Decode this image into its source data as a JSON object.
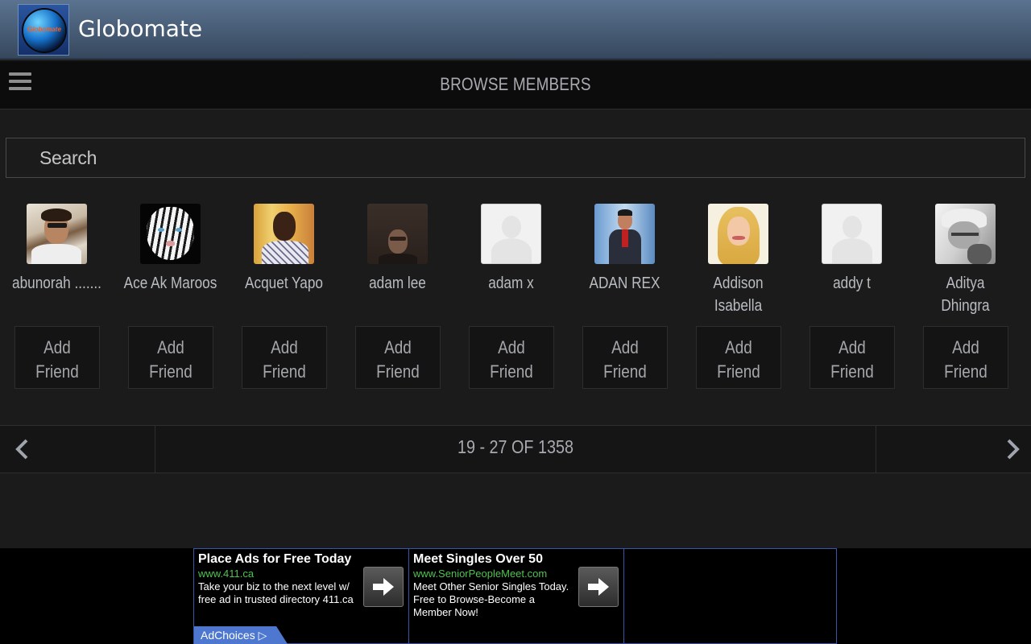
{
  "app": {
    "title": "Globomate",
    "logo_text": "Globomate"
  },
  "header": {
    "heading": "BROWSE MEMBERS",
    "menu_icon": "hamburger-menu-icon"
  },
  "search": {
    "placeholder": "Search",
    "value": ""
  },
  "members": [
    {
      "name": "abunorah .......",
      "button": "Add\nFriend",
      "photo": "man-with-sunglasses"
    },
    {
      "name": "Ace Ak Maroos",
      "button": "Add\nFriend",
      "photo": "white-tiger"
    },
    {
      "name": "Acquet Yapo",
      "button": "Add\nFriend",
      "photo": "man-smiling"
    },
    {
      "name": "adam lee",
      "button": "Add\nFriend",
      "photo": "dark-portrait"
    },
    {
      "name": "adam x",
      "button": "Add\nFriend",
      "photo": "default-avatar"
    },
    {
      "name": "ADAN REX",
      "button": "Add\nFriend",
      "photo": "man-in-suit"
    },
    {
      "name": "Addison\nIsabella",
      "button": "Add\nFriend",
      "photo": "blonde-woman"
    },
    {
      "name": "addy t",
      "button": "Add\nFriend",
      "photo": "default-avatar"
    },
    {
      "name": "Aditya\nDhingra",
      "button": "Add\nFriend",
      "photo": "grayscale-portrait"
    }
  ],
  "pager": {
    "range": "19 - 27 OF 1358",
    "prev_icon": "chevron-left-icon",
    "next_icon": "chevron-right-icon"
  },
  "ads": [
    {
      "title": "Place Ads for Free Today",
      "url": "www.411.ca",
      "text": "Take your biz to the next level w/ free ad in trusted directory 411.ca"
    },
    {
      "title": "Meet Singles Over 50",
      "url": "www.SeniorPeopleMeet.com",
      "text": "Meet Other Senior Singles Today. Free to Browse-Become a Member Now!"
    }
  ],
  "adchoices": "AdChoices",
  "colors": {
    "actionbar_top": "#5b7390",
    "actionbar_bottom": "#36485e",
    "background": "#1b1b1b",
    "ad_border": "#3a56a8",
    "ad_url": "#4fc24f",
    "adchoices": "#4e78d0"
  }
}
